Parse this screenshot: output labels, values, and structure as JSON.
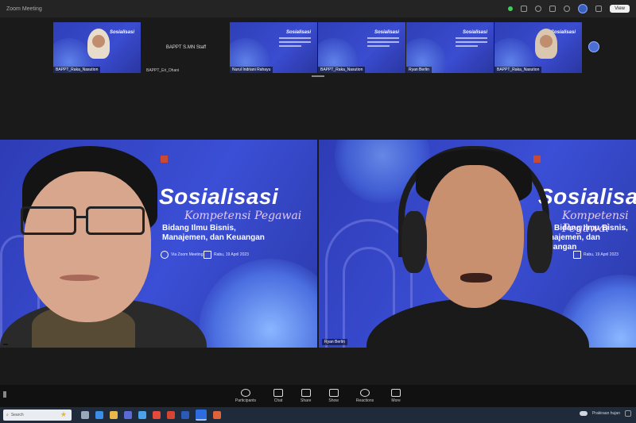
{
  "window": {
    "title": "Zoom Meeting",
    "top_items": [
      "View"
    ],
    "view_label": "View"
  },
  "gallery": {
    "thumbs": [
      {
        "title": "Sosialisasi",
        "name": "BAPPT_Raka_Nasution"
      },
      {
        "title": "",
        "name": "BAPPT_Eri_Dhani"
      },
      {
        "title": "Sosialisasi",
        "name": "Nurul Indriani Rahayu"
      },
      {
        "title": "Sosialisasi",
        "name": "BAPPT_Raka_Nasution"
      },
      {
        "title": "Sosialisasi",
        "name": "Ryan Berlin"
      },
      {
        "title": "Sosialisasi",
        "name": "BAPPT_Raka_Nasution"
      }
    ],
    "name_tile": "BAPPT S.MN Staff",
    "name_tile_footer": "BAPPT_Eri_Dhani"
  },
  "slide": {
    "title": "Sosialisasi",
    "script": "Kompetensi Pegawai",
    "subtitle_line1": "Bidang Ilmu Bisnis,",
    "subtitle_line2": "Manajemen, dan Keuangan",
    "meta1": "Via Zoom Meeting",
    "meta2": "Rabu, 19 April 2023"
  },
  "speakers": {
    "left_name": "",
    "right_name": "Ryan Berlin"
  },
  "toolbar": {
    "items": [
      "Participants",
      "Chat",
      "Share",
      "Show",
      "Reactions",
      "More"
    ]
  },
  "taskbar": {
    "search_placeholder": "Search",
    "weather": "Prakiraan hujan"
  },
  "colors": {
    "slide_blue": "#3b4fd6",
    "accent": "#2d6cdf"
  }
}
